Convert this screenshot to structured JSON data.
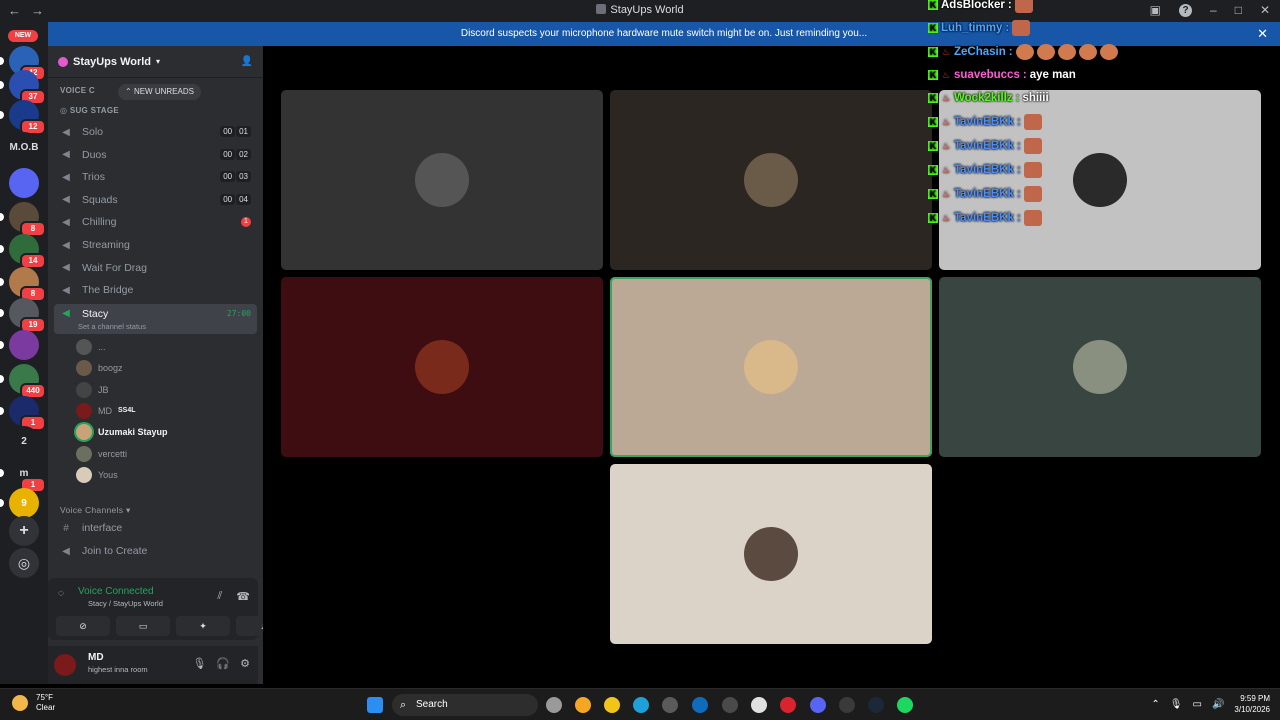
{
  "window": {
    "title": "StayUps World",
    "back_glyph": "←",
    "forward_glyph": "→",
    "minimize_glyph": "–",
    "maximize_glyph": "□",
    "close_glyph": "✕",
    "help_glyph": "?",
    "inbox_glyph": "▣"
  },
  "notice": {
    "text": "Discord suspects your microphone hardware mute switch might be on. Just reminding you...",
    "close_glyph": "✕"
  },
  "rail": {
    "new_label": "NEW",
    "servers": [
      {
        "label": "",
        "badge": "42",
        "color": "#2a62b8"
      },
      {
        "label": "",
        "badge": "37",
        "color": "#2a4fb0"
      },
      {
        "label": "",
        "badge": "12",
        "color": "#1a3a8c"
      },
      {
        "label": "M.O.B",
        "badge": "",
        "color": "#1e1f22"
      },
      {
        "label": "",
        "badge": "",
        "color": "#5865f2"
      },
      {
        "label": "",
        "badge": "8",
        "color": "#5a4a3a"
      },
      {
        "label": "",
        "badge": "14",
        "color": "#2f6b3b"
      },
      {
        "label": "",
        "badge": "8",
        "color": "#b07a4a"
      },
      {
        "label": "",
        "badge": "19",
        "color": "#55585f"
      },
      {
        "label": "",
        "badge": "",
        "color": "#7a3aa0"
      },
      {
        "label": "",
        "badge": "440",
        "color": "#3a7a4a"
      },
      {
        "label": "",
        "badge": "1",
        "color": "#1a2a6b"
      },
      {
        "label": "2",
        "badge": "",
        "color": "#1e1f22"
      },
      {
        "label": "m",
        "badge": "1",
        "color": "#1e1f22"
      },
      {
        "label": "9",
        "badge": "",
        "color": "#e8b200"
      }
    ],
    "add_glyph": "+",
    "discover_glyph": "◎"
  },
  "sidebar": {
    "server_name": "StayUps World",
    "invite_glyph": "👤",
    "partial_category": "VOICE C",
    "new_unreads": "NEW UNREADS",
    "stage_label": "SUG STAGE",
    "channels": [
      {
        "name": "Solo",
        "counter": [
          "00",
          "01"
        ]
      },
      {
        "name": "Duos",
        "counter": [
          "00",
          "02"
        ]
      },
      {
        "name": "Trios",
        "counter": [
          "00",
          "03"
        ]
      },
      {
        "name": "Squads",
        "counter": [
          "00",
          "04"
        ]
      },
      {
        "name": "Chilling",
        "badge": "1"
      },
      {
        "name": "Streaming"
      },
      {
        "name": "Wait For Drag"
      },
      {
        "name": "The Bridge"
      }
    ],
    "active_channel": {
      "name": "Stacy",
      "timer": "27:00",
      "status": "Set a channel status"
    },
    "members": [
      {
        "name": "...",
        "tag": "",
        "speaking": false,
        "color": "#555"
      },
      {
        "name": "boogz",
        "tag": "",
        "speaking": false,
        "color": "#6b5a4a"
      },
      {
        "name": "JB",
        "tag": "",
        "speaking": false,
        "color": "#444"
      },
      {
        "name": "MD",
        "tag": "SS4L",
        "speaking": false,
        "color": "#7a1a1a"
      },
      {
        "name": "Uzumaki Stayup",
        "tag": "",
        "speaking": true,
        "color": "#c9a27a"
      },
      {
        "name": "vercetti",
        "tag": "",
        "speaking": false,
        "color": "#6a7060"
      },
      {
        "name": "Yous",
        "tag": "",
        "speaking": false,
        "color": "#d8cbb8"
      }
    ],
    "voice_category": "Voice Channels",
    "text_channel": "interface",
    "join_channel": "Join to Create"
  },
  "voice_panel": {
    "title": "Voice Connected",
    "subtitle": "Stacy / StayUps World"
  },
  "user": {
    "name": "MD",
    "status": "highest inna room"
  },
  "tiles": [
    {
      "bg": "#333333",
      "avatar": "#555555",
      "speaking": false
    },
    {
      "bg": "#2b2622",
      "avatar": "#6a5a48",
      "speaking": false
    },
    {
      "bg": "#c2c2c2",
      "avatar": "#2a2a2a",
      "speaking": false
    },
    {
      "bg": "#3d0d12",
      "avatar": "#7a2a1a",
      "speaking": false
    },
    {
      "bg": "#bba995",
      "avatar": "#d9b98a",
      "speaking": true
    },
    {
      "bg": "#394540",
      "avatar": "#8a9080",
      "speaking": false
    },
    {
      "bg": "#dbd3c7",
      "avatar": "#5a4a40",
      "speaking": false
    }
  ],
  "chat": [
    {
      "user": "AdsBlocker",
      "text": "",
      "emotes": 1,
      "color": "#ffffff"
    },
    {
      "user": "Luh_timmy",
      "text": "",
      "emotes": 1,
      "color": "#4aa8ff"
    },
    {
      "user": "ZeChasin",
      "text": "",
      "emotes": 5,
      "color": "#4aa8ff"
    },
    {
      "user": "suavebuccs",
      "text": "aye man",
      "emotes": 0,
      "color": "#ff5cd6"
    },
    {
      "user": "Wock2killz",
      "text": "shiiii",
      "emotes": 0,
      "color": "#53fc18"
    },
    {
      "user": "TavinEBKk",
      "text": "",
      "emotes": 1,
      "color": "#4a8cff"
    },
    {
      "user": "TavinEBKk",
      "text": "",
      "emotes": 1,
      "color": "#4a8cff"
    },
    {
      "user": "TavinEBKk",
      "text": "",
      "emotes": 1,
      "color": "#4a8cff"
    },
    {
      "user": "TavinEBKk",
      "text": "",
      "emotes": 1,
      "color": "#4a8cff"
    },
    {
      "user": "TavinEBKk",
      "text": "",
      "emotes": 1,
      "color": "#4a8cff"
    }
  ],
  "taskbar": {
    "temperature": "75°F",
    "condition": "Clear",
    "search_label": "Search",
    "time": "9:59 PM",
    "date": "3/10/2026"
  }
}
